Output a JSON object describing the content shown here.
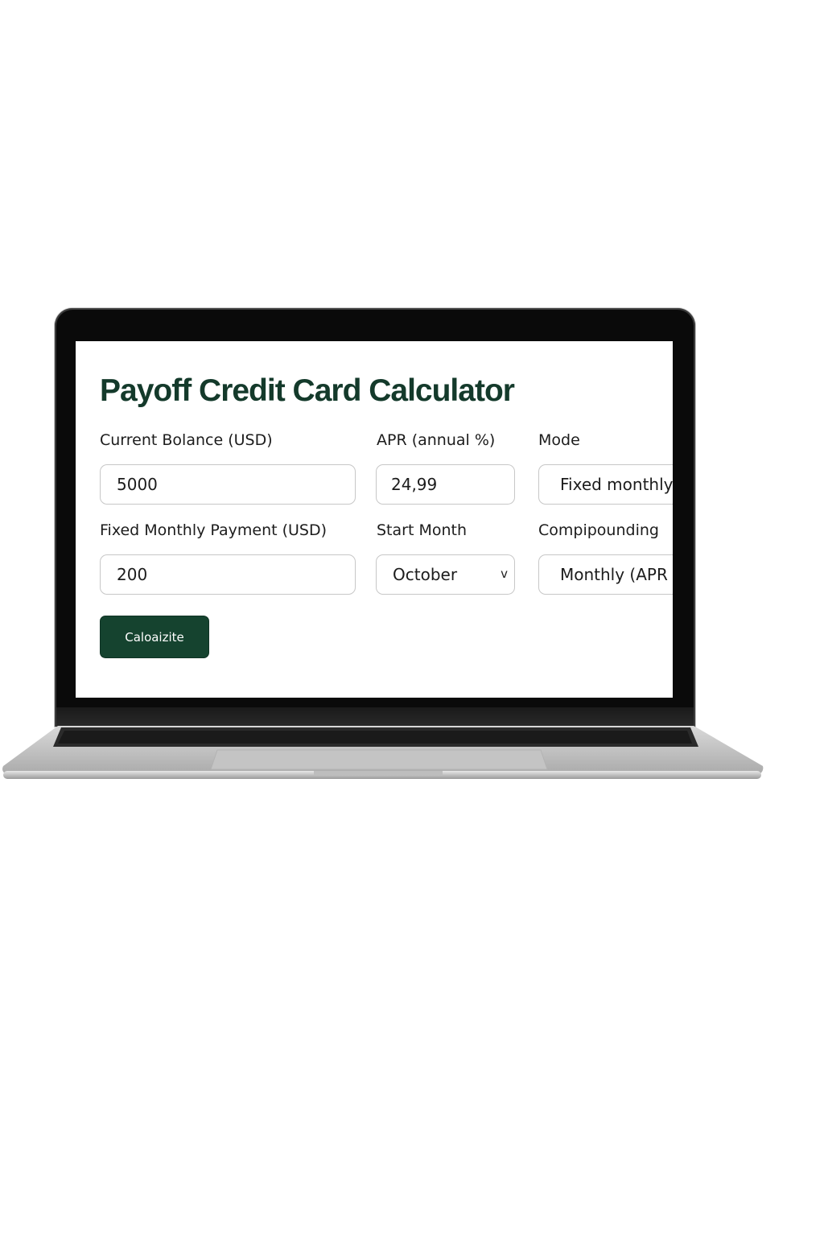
{
  "title": "Payoff Credit Card Calculator",
  "fields": {
    "balance": {
      "label": "Current Bolance (USD)",
      "value": "5000"
    },
    "apr": {
      "label": "APR (annual %)",
      "value": "24,99"
    },
    "mode": {
      "label": "Mode",
      "value": "Fixed monthly"
    },
    "payment": {
      "label": "Fixed Monthly Payment (USD)",
      "value": "200"
    },
    "start_month": {
      "label": "Start Month",
      "value": "October",
      "chevron": "v"
    },
    "compounding": {
      "label": "Compipounding",
      "value": "Monthly (APR"
    }
  },
  "button": {
    "label": "Caloaizite"
  },
  "colors": {
    "accent": "#15432f",
    "title": "#143a2b"
  },
  "icons": {
    "select_chevron": "chevron-down-icon"
  }
}
